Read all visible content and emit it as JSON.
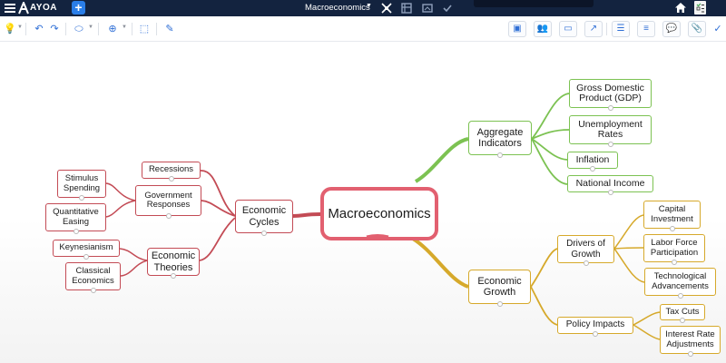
{
  "app": {
    "name": "AYOA",
    "document_title": "Macroeconomics"
  },
  "colors": {
    "topbar": "#13233f",
    "accent": "#2a7ee8",
    "center_border": "#e26070",
    "left_branch": "#c34b55",
    "top_right_branch": "#7cc252",
    "bottom_right_branch": "#d6a92b"
  },
  "toolbar": {
    "left_icons": [
      "lightbulb-icon",
      "undo-icon",
      "redo-icon",
      "shape-icon",
      "add-icon",
      "select-icon",
      "format-icon"
    ],
    "right_icons": [
      "ai-icon",
      "share-icon",
      "present-icon",
      "export-icon",
      "outline-icon",
      "notes-icon",
      "comment-icon",
      "attach-icon",
      "task-icon"
    ]
  },
  "mindmap": {
    "center": "Macroeconomics",
    "nodes": {
      "economic_cycles": "Economic\nCycles",
      "recessions": "Recessions",
      "government_responses": "Government\nResponses",
      "stimulus_spending": "Stimulus\nSpending",
      "quantitative_easing": "Quantitative\nEasing",
      "economic_theories": "Economic\nTheories",
      "keynesianism": "Keynesianism",
      "classical_economics": "Classical\nEconomics",
      "aggregate_indicators": "Aggregate\nIndicators",
      "gdp": "Gross Domestic\nProduct (GDP)",
      "unemployment": "Unemployment\nRates",
      "inflation": "Inflation",
      "national_income": "National Income",
      "economic_growth": "Economic\nGrowth",
      "drivers_of_growth": "Drivers of\nGrowth",
      "capital_investment": "Capital\nInvestment",
      "labor_force": "Labor Force\nParticipation",
      "tech_advancements": "Technological\nAdvancements",
      "policy_impacts": "Policy Impacts",
      "tax_cuts": "Tax Cuts",
      "interest_rate": "Interest Rate\nAdjustments"
    }
  }
}
